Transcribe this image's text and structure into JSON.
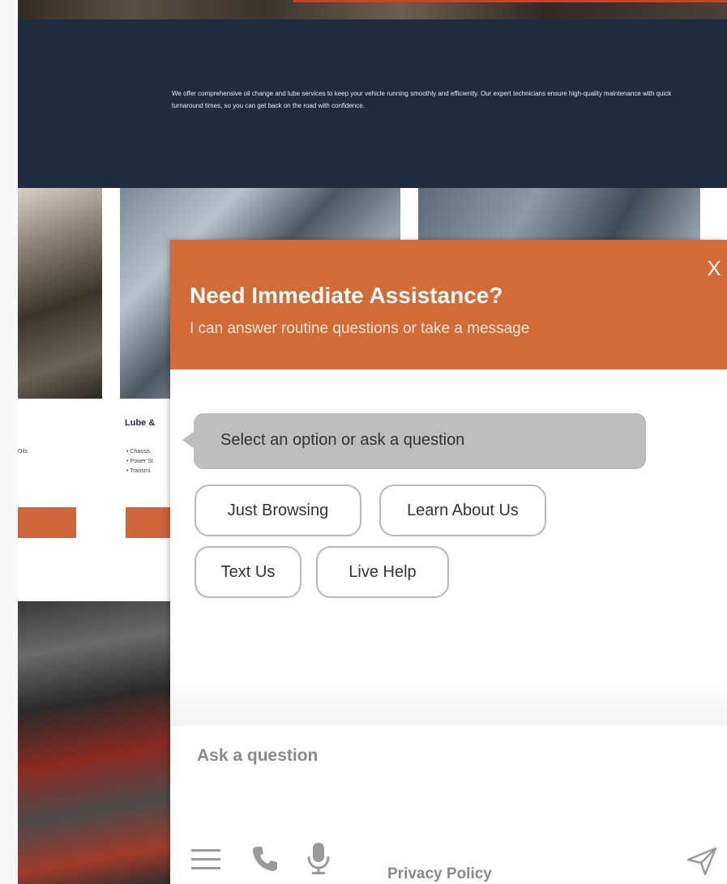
{
  "site": {
    "hero_text": "We offer comprehensive oil change and lube services to keep your vehicle running smoothly and efficiently. Our expert technicians ensure high-quality maintenance with quick turnaround times, so you can get back on the road with confidence.",
    "card_heading": "Lube &",
    "card1_list": "Oils",
    "card2_list": [
      "Chassis",
      "Power St",
      "Transmi"
    ]
  },
  "chat": {
    "title": "Need Immediate Assistance?",
    "subtitle": "I can answer routine questions or take a message",
    "close_label": "X",
    "bubble_text": "Select an option or ask a question",
    "options": [
      "Just Browsing",
      "Learn About Us",
      "Text Us",
      "Live Help"
    ],
    "input_placeholder": "Ask a question",
    "privacy_label": "Privacy Policy"
  },
  "colors": {
    "header_orange": "#d36b37",
    "hero_navy": "#1f2b3f",
    "bubble_gray": "#bdbdbd",
    "icon_gray": "#9a9a9a"
  },
  "icons": [
    "close-icon",
    "menu-icon",
    "phone-icon",
    "microphone-icon",
    "send-icon"
  ]
}
